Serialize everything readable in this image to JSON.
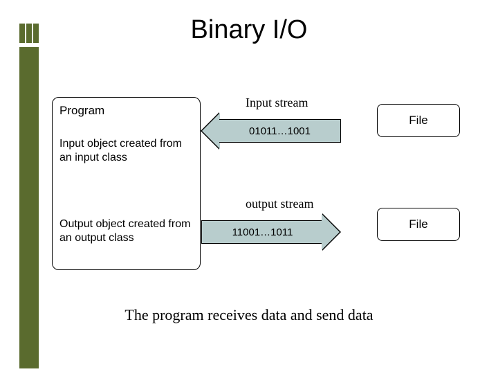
{
  "title": "Binary I/O",
  "program": {
    "heading": "Program",
    "input_obj": "Input object created from an input class",
    "output_obj": "Output object created from an output class"
  },
  "streams": {
    "input_label": "Input stream",
    "input_data": "01011…1001",
    "output_label": "output stream",
    "output_data": "11001…1011"
  },
  "file_label_top": "File",
  "file_label_bottom": "File",
  "caption": "The program receives data and send data"
}
